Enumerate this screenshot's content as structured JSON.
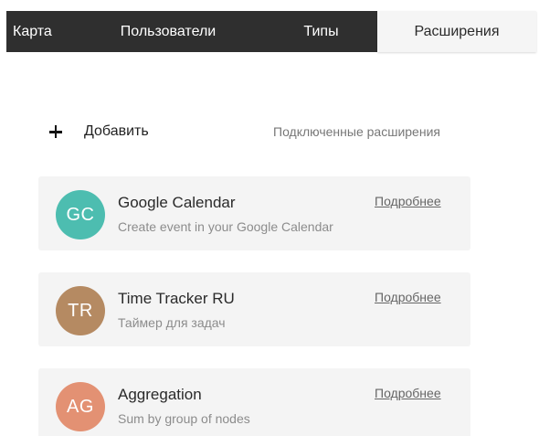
{
  "tabs": {
    "map": "Карта",
    "users": "Пользователи",
    "types": "Типы",
    "extensions": "Расширения",
    "active": "extensions"
  },
  "toolbar": {
    "add_label": "Добавить",
    "connected_label": "Подключенные расширения"
  },
  "extensions": [
    {
      "initials": "GC",
      "title": "Google Calendar",
      "description": "Create event in your Google Calendar",
      "more": "Подробнее",
      "color": "#4dbdb0"
    },
    {
      "initials": "TR",
      "title": "Time Tracker RU",
      "description": "Таймер для задач",
      "more": "Подробнее",
      "color": "#b58a62"
    },
    {
      "initials": "AG",
      "title": "Aggregation",
      "description": "Sum by group of nodes",
      "more": "Подробнее",
      "color": "#e39173"
    }
  ]
}
